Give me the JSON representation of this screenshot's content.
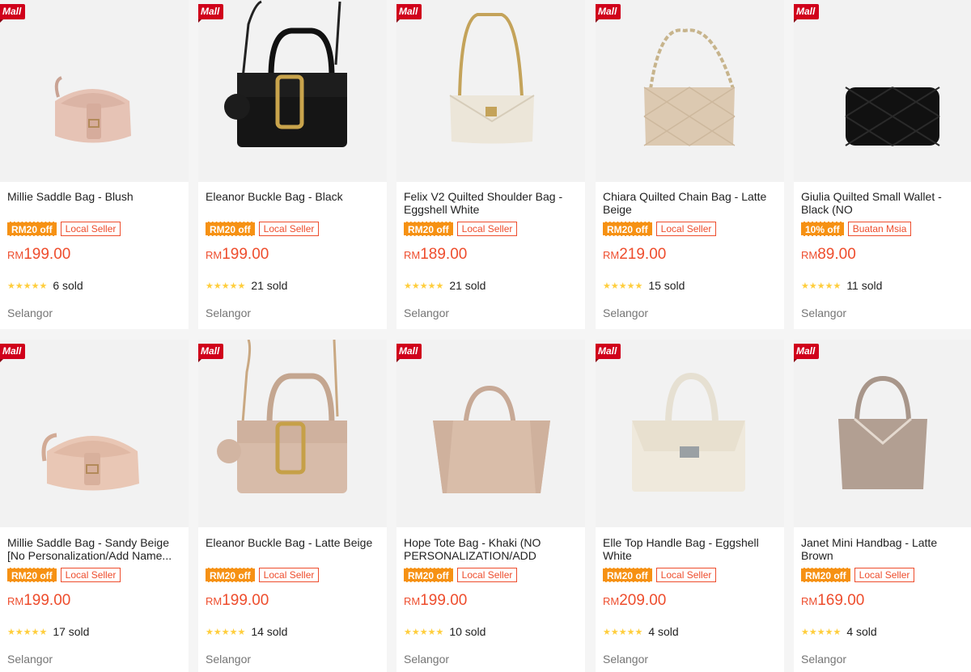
{
  "mall_badge": "Mall",
  "currency": "RM",
  "stars": "★★★★★",
  "products": [
    {
      "title": "Millie Saddle Bag - Blush",
      "discount": "RM20 off",
      "tag": "Local Seller",
      "price": "199.00",
      "sold": "6 sold",
      "location": "Selangor"
    },
    {
      "title": "Eleanor Buckle Bag - Black",
      "discount": "RM20 off",
      "tag": "Local Seller",
      "price": "199.00",
      "sold": "21 sold",
      "location": "Selangor"
    },
    {
      "title": "Felix V2 Quilted Shoulder Bag - Eggshell White",
      "discount": "RM20 off",
      "tag": "Local Seller",
      "price": "189.00",
      "sold": "21 sold",
      "location": "Selangor"
    },
    {
      "title": "Chiara Quilted Chain Bag - Latte Beige",
      "discount": "RM20 off",
      "tag": "Local Seller",
      "price": "219.00",
      "sold": "15 sold",
      "location": "Selangor"
    },
    {
      "title": "Giulia Quilted Small Wallet - Black (NO PERSONALIZATION/ADD...",
      "discount": "10% off",
      "tag": "Buatan Msia",
      "price": "89.00",
      "sold": "11 sold",
      "location": "Selangor"
    },
    {
      "title": "Millie Saddle Bag - Sandy Beige [No Personalization/Add Name...",
      "discount": "RM20 off",
      "tag": "Local Seller",
      "price": "199.00",
      "sold": "17 sold",
      "location": "Selangor"
    },
    {
      "title": "Eleanor Buckle Bag - Latte Beige",
      "discount": "RM20 off",
      "tag": "Local Seller",
      "price": "199.00",
      "sold": "14 sold",
      "location": "Selangor"
    },
    {
      "title": "Hope Tote Bag - Khaki (NO PERSONALIZATION/ADD NAME...",
      "discount": "RM20 off",
      "tag": "Local Seller",
      "price": "199.00",
      "sold": "10 sold",
      "location": "Selangor"
    },
    {
      "title": "Elle Top Handle Bag - Eggshell White",
      "discount": "RM20 off",
      "tag": "Local Seller",
      "price": "209.00",
      "sold": "4 sold",
      "location": "Selangor"
    },
    {
      "title": "Janet Mini Handbag - Latte Brown",
      "discount": "RM20 off",
      "tag": "Local Seller",
      "price": "169.00",
      "sold": "4 sold",
      "location": "Selangor"
    }
  ]
}
